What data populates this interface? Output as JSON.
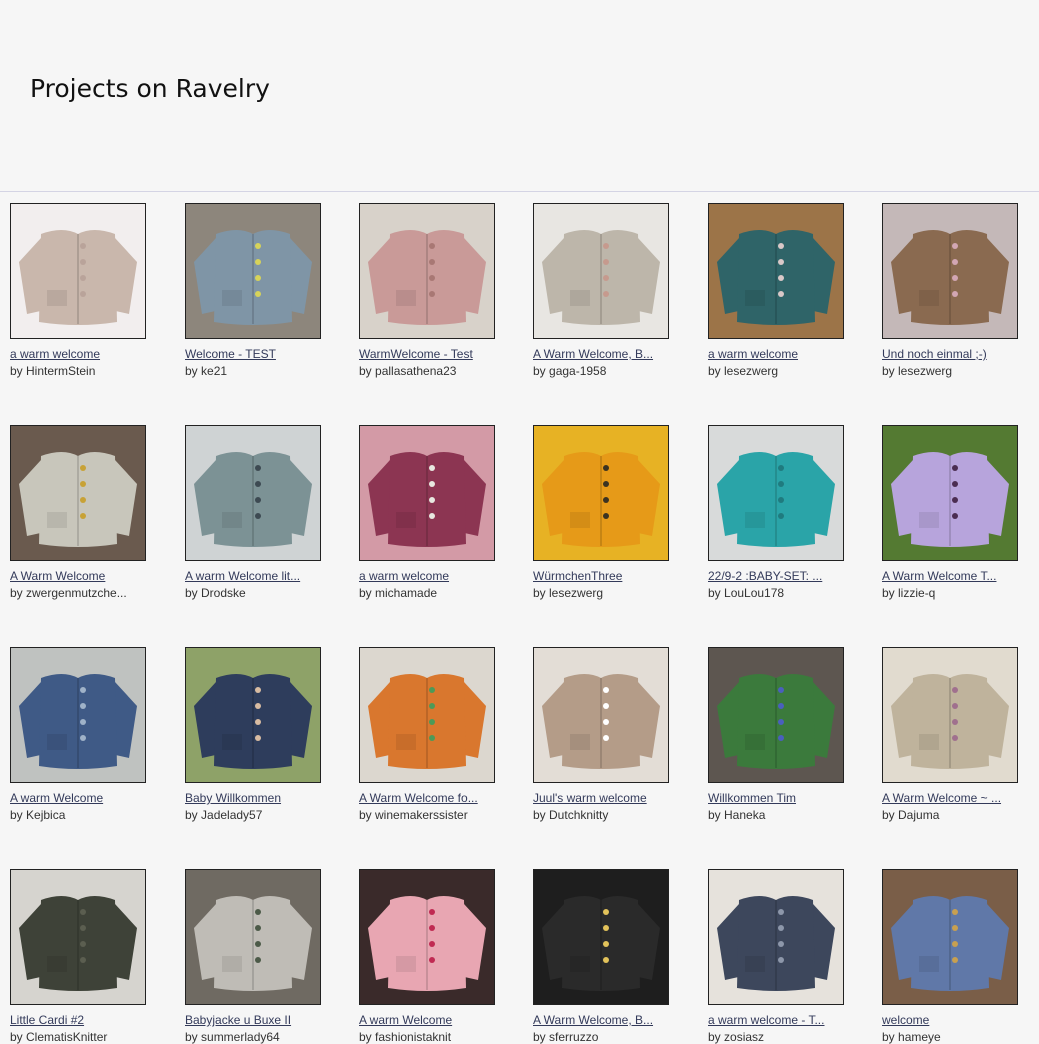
{
  "page": {
    "title": "Projects on Ravelry",
    "by_prefix": "by "
  },
  "projects": [
    {
      "title": "a warm welcome",
      "user": "HintermStein",
      "bg": "#f2eeee",
      "garment": "#c9b7ac",
      "accent": "#b9a39a"
    },
    {
      "title": "Welcome - TEST",
      "user": "ke21",
      "bg": "#8d867c",
      "garment": "#7f95a6",
      "accent": "#d6d35a"
    },
    {
      "title": "WarmWelcome - Test",
      "user": "pallasathena23",
      "bg": "#d8d2ca",
      "garment": "#c99a98",
      "accent": "#a87874"
    },
    {
      "title": "A Warm Welcome, B...",
      "user": "gaga-1958",
      "bg": "#e8e6e2",
      "garment": "#bdb6aa",
      "accent": "#c69a8e"
    },
    {
      "title": "a warm welcome",
      "user": "lesezwerg",
      "bg": "#9c7448",
      "garment": "#2f6468",
      "accent": "#d9c8c8"
    },
    {
      "title": "Und noch einmal ;-)",
      "user": "lesezwerg",
      "bg": "#c4b8b8",
      "garment": "#8a6a50",
      "accent": "#d2a6b3"
    },
    {
      "title": "A Warm Welcome",
      "user": "zwergenmutzche...",
      "bg": "#6a5a4e",
      "garment": "#c8c6bb",
      "accent": "#c8a236"
    },
    {
      "title": "A warm Welcome lit...",
      "user": "Drodske",
      "bg": "#cfd3d4",
      "garment": "#7c9295",
      "accent": "#3d4a52"
    },
    {
      "title": "a warm welcome",
      "user": "michamade",
      "bg": "#d39aa6",
      "garment": "#8c3552",
      "accent": "#e8e8e0"
    },
    {
      "title": "WürmchenThree",
      "user": "lesezwerg",
      "bg": "#e7b224",
      "garment": "#e69a18",
      "accent": "#3b3322"
    },
    {
      "title": "22/9-2 :BABY-SET: ...",
      "user": "LouLou178",
      "bg": "#d8dada",
      "garment": "#2aa4a8",
      "accent": "#1f7b7f"
    },
    {
      "title": "A Warm Welcome T...",
      "user": "lizzie-q",
      "bg": "#547a32",
      "garment": "#b7a4dc",
      "accent": "#4b2d52"
    },
    {
      "title": "A warm Welcome",
      "user": "Kejbica",
      "bg": "#bfc2c0",
      "garment": "#3f5a86",
      "accent": "#9fb2c8"
    },
    {
      "title": "Baby Willkommen",
      "user": "Jadelady57",
      "bg": "#8ea268",
      "garment": "#2e3d5c",
      "accent": "#d8bca2"
    },
    {
      "title": "A Warm Welcome fo...",
      "user": "winemakerssister",
      "bg": "#dcd7cf",
      "garment": "#d9772e",
      "accent": "#4c9a58"
    },
    {
      "title": "Juul's warm welcome",
      "user": "Dutchknitty",
      "bg": "#e3ddd6",
      "garment": "#b49c88",
      "accent": "#ffffff"
    },
    {
      "title": "Willkommen Tim",
      "user": "Haneka",
      "bg": "#5d5650",
      "garment": "#3b7a3c",
      "accent": "#4a5fbe"
    },
    {
      "title": "A Warm Welcome ~ ...",
      "user": "Dajuma",
      "bg": "#e1dbcf",
      "garment": "#bfb39c",
      "accent": "#a0708e"
    },
    {
      "title": "Little Cardi #2",
      "user": "ClematisKnitter",
      "bg": "#d6d4cf",
      "garment": "#3e4238",
      "accent": "#5b5e50"
    },
    {
      "title": "Babyjacke u Buxe II",
      "user": "summerlady64",
      "bg": "#6f6a62",
      "garment": "#bfbcb6",
      "accent": "#4c5a48"
    },
    {
      "title": "A warm Welcome",
      "user": "fashionistaknit",
      "bg": "#3a2a2a",
      "garment": "#e8a6b2",
      "accent": "#c02a52"
    },
    {
      "title": "A Warm Welcome, B...",
      "user": "sferruzzo",
      "bg": "#1e1e1e",
      "garment": "#2a2a2a",
      "accent": "#e2c25a"
    },
    {
      "title": "a warm welcome - T...",
      "user": "zosiasz",
      "bg": "#e6e2dc",
      "garment": "#3d475c",
      "accent": "#8d97aa"
    },
    {
      "title": "welcome",
      "user": "hameye",
      "bg": "#7a5e48",
      "garment": "#6078a8",
      "accent": "#c8a050"
    }
  ]
}
